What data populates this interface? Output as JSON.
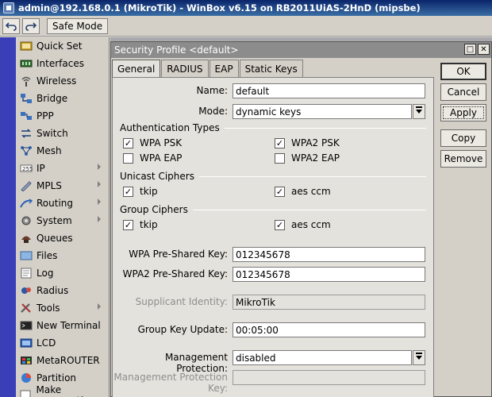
{
  "window": {
    "title": "admin@192.168.0.1 (MikroTik) - WinBox v6.15 on RB2011UiAS-2HnD (mipsbe)"
  },
  "toolbar": {
    "undo_icon": "undo-icon",
    "redo_icon": "redo-icon",
    "safe_mode_label": "Safe Mode"
  },
  "sidebar": {
    "items": [
      {
        "label": "Quick Set",
        "icon": "quick-set-icon",
        "submenu": false
      },
      {
        "label": "Interfaces",
        "icon": "interfaces-icon",
        "submenu": false
      },
      {
        "label": "Wireless",
        "icon": "wireless-icon",
        "submenu": false
      },
      {
        "label": "Bridge",
        "icon": "bridge-icon",
        "submenu": false
      },
      {
        "label": "PPP",
        "icon": "ppp-icon",
        "submenu": false
      },
      {
        "label": "Switch",
        "icon": "switch-icon",
        "submenu": false
      },
      {
        "label": "Mesh",
        "icon": "mesh-icon",
        "submenu": false
      },
      {
        "label": "IP",
        "icon": "ip-icon",
        "submenu": true
      },
      {
        "label": "MPLS",
        "icon": "mpls-icon",
        "submenu": true
      },
      {
        "label": "Routing",
        "icon": "routing-icon",
        "submenu": true
      },
      {
        "label": "System",
        "icon": "system-icon",
        "submenu": true
      },
      {
        "label": "Queues",
        "icon": "queues-icon",
        "submenu": false
      },
      {
        "label": "Files",
        "icon": "files-icon",
        "submenu": false
      },
      {
        "label": "Log",
        "icon": "log-icon",
        "submenu": false
      },
      {
        "label": "Radius",
        "icon": "radius-icon",
        "submenu": false
      },
      {
        "label": "Tools",
        "icon": "tools-icon",
        "submenu": true
      },
      {
        "label": "New Terminal",
        "icon": "terminal-icon",
        "submenu": false
      },
      {
        "label": "LCD",
        "icon": "lcd-icon",
        "submenu": false
      },
      {
        "label": "MetaROUTER",
        "icon": "metarouter-icon",
        "submenu": false
      },
      {
        "label": "Partition",
        "icon": "partition-icon",
        "submenu": false
      },
      {
        "label": "Make Supout.rif",
        "icon": "supout-icon",
        "submenu": false
      }
    ]
  },
  "dialog": {
    "title": "Security Profile <default>",
    "tabs": [
      "General",
      "RADIUS",
      "EAP",
      "Static Keys"
    ],
    "active_tab": "General",
    "name_label": "Name:",
    "name_value": "default",
    "mode_label": "Mode:",
    "mode_value": "dynamic keys",
    "auth_types_header": "Authentication Types",
    "auth": {
      "wpa_psk": {
        "label": "WPA PSK",
        "checked": true
      },
      "wpa2_psk": {
        "label": "WPA2 PSK",
        "checked": true
      },
      "wpa_eap": {
        "label": "WPA EAP",
        "checked": false
      },
      "wpa2_eap": {
        "label": "WPA2 EAP",
        "checked": false
      }
    },
    "unicast_header": "Unicast Ciphers",
    "unicast": {
      "tkip": {
        "label": "tkip",
        "checked": true
      },
      "aes": {
        "label": "aes ccm",
        "checked": true
      }
    },
    "group_header": "Group Ciphers",
    "group": {
      "tkip": {
        "label": "tkip",
        "checked": true
      },
      "aes": {
        "label": "aes ccm",
        "checked": true
      }
    },
    "wpa_psk_key_label": "WPA Pre-Shared Key:",
    "wpa_psk_key_value": "012345678",
    "wpa2_psk_key_label": "WPA2 Pre-Shared Key:",
    "wpa2_psk_key_value": "012345678",
    "supplicant_label": "Supplicant Identity:",
    "supplicant_value": "MikroTik",
    "group_key_update_label": "Group Key Update:",
    "group_key_update_value": "00:05:00",
    "mgmt_protection_label": "Management Protection:",
    "mgmt_protection_value": "disabled",
    "mgmt_protection_key_label": "Management Protection Key:",
    "mgmt_protection_key_value": "",
    "buttons": {
      "ok": "OK",
      "cancel": "Cancel",
      "apply": "Apply",
      "copy": "Copy",
      "remove": "Remove"
    },
    "minimize_glyph": "□",
    "close_glyph": "✕"
  }
}
